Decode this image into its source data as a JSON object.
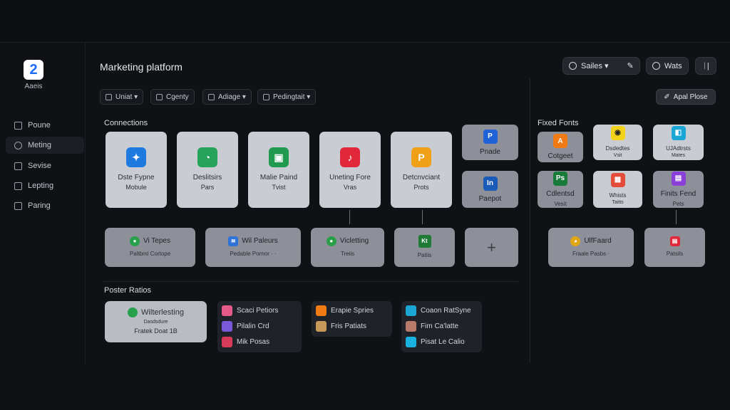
{
  "app": {
    "logo_glyph": "2",
    "logo_label": "Aaeis",
    "title": "Marketing platform"
  },
  "sidebar": {
    "items": [
      {
        "label": "Poune",
        "active": false
      },
      {
        "label": "Meting",
        "active": true
      },
      {
        "label": "Sevise",
        "active": false
      },
      {
        "label": "Lepting",
        "active": false
      },
      {
        "label": "Paring",
        "active": false
      }
    ]
  },
  "header": {
    "buttons": [
      {
        "label": "Sailes ▾",
        "icon": "circle-icon"
      },
      {
        "label": "Wats",
        "icon": "circle-icon"
      }
    ],
    "icon_button": "ᛁ|"
  },
  "filters": [
    {
      "label": "Uniat ▾"
    },
    {
      "label": "Cgenty"
    },
    {
      "label": "Adiage ▾"
    },
    {
      "label": "Pedingtait ▾"
    }
  ],
  "apply_button": {
    "label": "Apal Plose"
  },
  "connections": {
    "title": "Connections",
    "cards": [
      {
        "line1": "Dste Fypne",
        "line2": "Mobule",
        "color": "#1f7ae0",
        "glyph": "✦"
      },
      {
        "line1": "Deslitsirs",
        "line2": "Pars",
        "color": "#25a35a",
        "glyph": "◔"
      },
      {
        "line1": "Malie Paind",
        "line2": "Tvist",
        "color": "#1f9a4e",
        "glyph": "▣"
      },
      {
        "line1": "Uneting Fore",
        "line2": "Vras",
        "color": "#e0283a",
        "glyph": "♪"
      },
      {
        "line1": "Detcnvciant",
        "line2": "Prots",
        "color": "#f0a014",
        "glyph": "P"
      }
    ],
    "small_cards": [
      {
        "line1": "Pnade",
        "color": "#1f62d8",
        "glyph": "P"
      },
      {
        "line1": "Paepot",
        "color": "#1a5bb8",
        "glyph": "In"
      }
    ],
    "bottom_cards": [
      {
        "line1": "Vi Tepes",
        "line2": "Paltbml Cortope",
        "color": "#26a04a",
        "glyph": "●"
      },
      {
        "line1": "Wil Paleurs",
        "line2": "Pedable Pornor · ·",
        "color": "#2f73d6",
        "glyph": "≋"
      },
      {
        "line1": "Vicletting",
        "line2": "Treiis",
        "color": "#2a9e48",
        "glyph": "●"
      },
      {
        "line1": "Kt",
        "line2": "Patiis",
        "color": "#1e7a35",
        "glyph": "K"
      },
      {
        "line1": "+",
        "line2": ""
      }
    ]
  },
  "fixed_fonts": {
    "title": "Fixed Fonts",
    "cards": [
      {
        "line1": "Cotgeet",
        "line2": "",
        "color": "#f07a14",
        "glyph": "A"
      },
      {
        "line1": "Dsdedtes",
        "line2": "Vsit",
        "color": "#f3d21a",
        "glyph": "◉"
      },
      {
        "line1": "UJAdtrsts",
        "line2": "Mates",
        "color": "#1ba6d6",
        "glyph": "◧"
      },
      {
        "line1": "Cdlentsd",
        "line2": "Vesit",
        "color": "#1a7a3a",
        "glyph": "Ps"
      },
      {
        "line1": "Whists",
        "line2": "Taitts",
        "color": "#e44d3a",
        "glyph": "▦"
      },
      {
        "line1": "Finits Fend",
        "line2": "Pets",
        "color": "#8a3fd8",
        "glyph": "▤"
      }
    ],
    "bottom_cards": [
      {
        "line1": "UlfFaard",
        "line2": "Fraale Pasbs ·",
        "color": "#e0a614",
        "glyph": "◕"
      },
      {
        "line1": "Patsils",
        "line2": "",
        "color": "#e0283a",
        "glyph": "▤"
      }
    ]
  },
  "poster_ratios": {
    "title": "Poster Ratios",
    "feature": {
      "line1": "Wilterlesting",
      "line2": "Dasdsdure",
      "line3": "Fratek Doat 1B",
      "color": "#26a04a"
    },
    "groups": [
      {
        "items": [
          {
            "label": "Scaci Petiors",
            "color": "#e65a8a"
          },
          {
            "label": "Pilalin Crd",
            "color": "#7a5ad8"
          },
          {
            "label": "Mik Posas",
            "color": "#d83a5a"
          }
        ]
      },
      {
        "items": [
          {
            "label": "Erapie Spries",
            "color": "#f07a14"
          },
          {
            "label": "Fris Patiats",
            "color": "#c89a5a"
          }
        ]
      },
      {
        "items": [
          {
            "label": "Coaon RatSyne",
            "color": "#1ba6d6"
          },
          {
            "label": "Fim Ca'latte",
            "color": "#b87a6a"
          },
          {
            "label": "Pisat Le Calio",
            "color": "#1ab0e0"
          }
        ]
      }
    ]
  }
}
